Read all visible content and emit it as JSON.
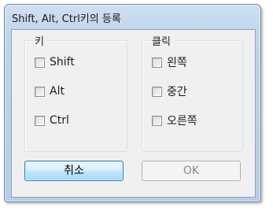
{
  "window": {
    "title": "Shift, Alt, Ctrl키의 등록"
  },
  "key_group": {
    "label": "키",
    "items": [
      {
        "label": "Shift",
        "checked": false
      },
      {
        "label": "Alt",
        "checked": false
      },
      {
        "label": "Ctrl",
        "checked": false
      }
    ]
  },
  "click_group": {
    "label": "클릭",
    "items": [
      {
        "label": "왼쪽",
        "checked": false
      },
      {
        "label": "중간",
        "checked": false
      },
      {
        "label": "오른쪽",
        "checked": false
      }
    ]
  },
  "buttons": {
    "cancel_label": "취소",
    "ok_label": "OK",
    "ok_enabled": false
  },
  "colors": {
    "accent_button_border": "#3c7fb1",
    "disabled_text": "#8a8a8a"
  }
}
